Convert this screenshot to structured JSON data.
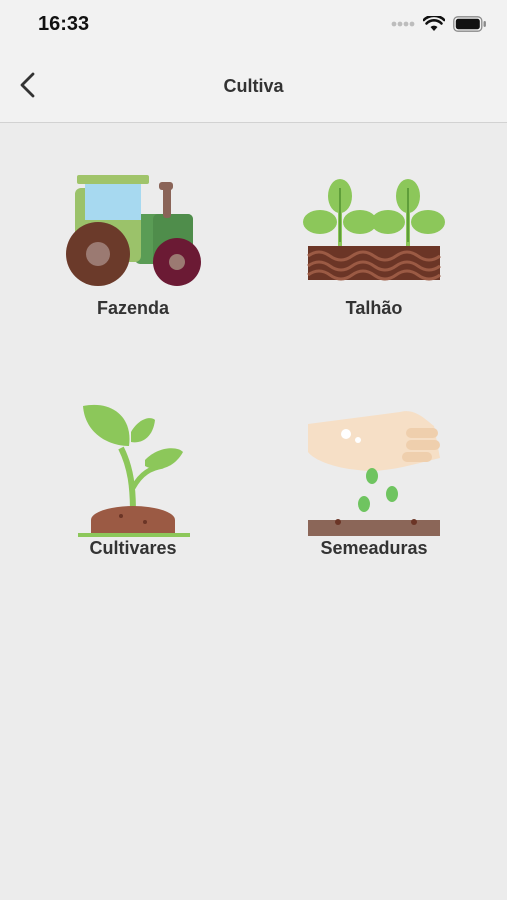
{
  "status": {
    "time": "16:33",
    "icons": [
      "signal-icon",
      "wifi-icon",
      "battery-icon"
    ]
  },
  "nav": {
    "title": "Cultiva",
    "back_icon": "chevron-left-icon"
  },
  "menu": {
    "items": [
      {
        "label": "Fazenda",
        "icon": "tractor-icon"
      },
      {
        "label": "Talhão",
        "icon": "field-plot-icon"
      },
      {
        "label": "Cultivares",
        "icon": "sprout-icon"
      },
      {
        "label": "Semeaduras",
        "icon": "sowing-hand-icon"
      }
    ]
  },
  "colors": {
    "background": "#ececec",
    "bar": "#f2f2f2",
    "leaf_green": "#8cc75a",
    "soil_brown": "#6b3526"
  }
}
